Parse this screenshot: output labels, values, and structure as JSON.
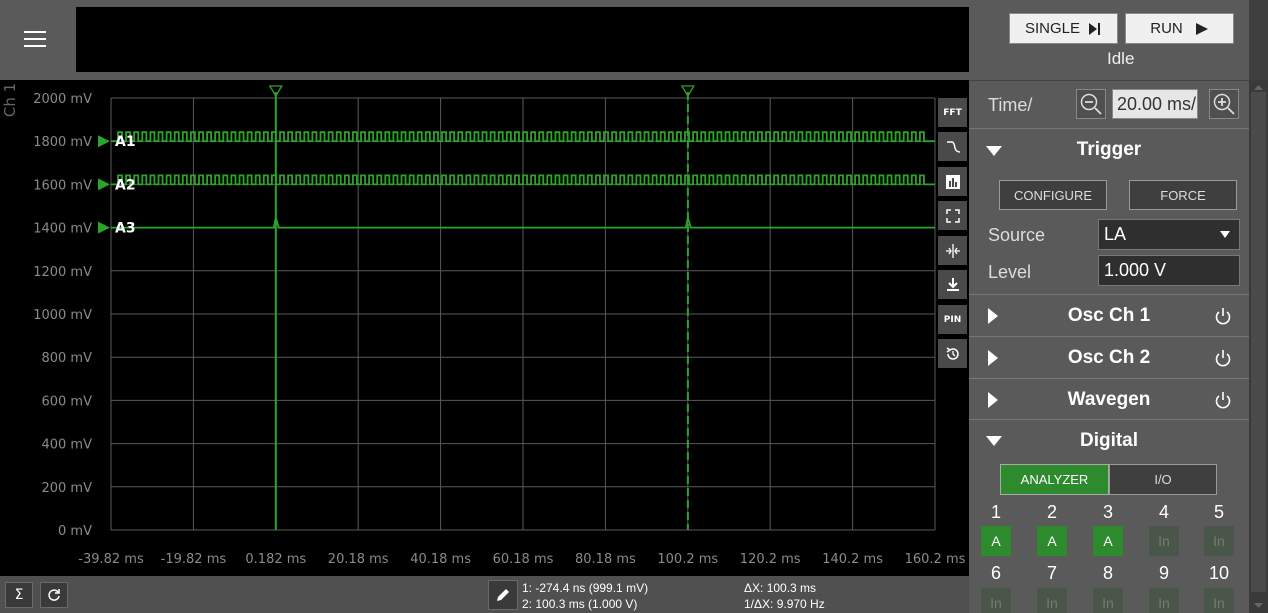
{
  "header": {
    "menu_icon": "hamburger-icon"
  },
  "plot": {
    "channel_label": "Ch 1",
    "y_ticks": [
      "2000 mV",
      "1800 mV",
      "1600 mV",
      "1400 mV",
      "1200 mV",
      "1000 mV",
      "800 mV",
      "600 mV",
      "400 mV",
      "200 mV",
      "0 mV"
    ],
    "x_ticks": [
      "-39.82 ms",
      "-19.82 ms",
      "0.182 ms",
      "20.18 ms",
      "40.18 ms",
      "60.18 ms",
      "80.18 ms",
      "100.2 ms",
      "120.2 ms",
      "140.2 ms",
      "160.2 ms"
    ],
    "channels": [
      {
        "label": "A1",
        "level_mv": 1800,
        "pattern": "square"
      },
      {
        "label": "A2",
        "level_mv": 1600,
        "pattern": "square"
      },
      {
        "label": "A3",
        "level_mv": 1400,
        "pattern": "flat"
      }
    ],
    "trace_color": "#2aa52a",
    "cursors_ms": [
      0.182,
      100.2
    ]
  },
  "tools": [
    "FFT",
    "~",
    "bar-chart-icon",
    "fullscreen-icon",
    "fit-icon",
    "download-icon",
    "PIN",
    "reset-icon"
  ],
  "tool_labels": {
    "fft": "FFT",
    "pin": "PIN"
  },
  "bottom": {
    "cursor1": "1: -274.4 ns (999.1 mV)",
    "cursor2": "2: 100.3 ms (1.000 V)",
    "delta_x": "ΔX: 100.3 ms",
    "inv_delta_x": "1/ΔX: 9.970 Hz"
  },
  "panel": {
    "single_label": "SINGLE",
    "run_label": "RUN",
    "status": "Idle",
    "time_label": "Time/",
    "time_value": "20.00 ms/",
    "trigger": {
      "title": "Trigger",
      "configure": "CONFIGURE",
      "force": "FORCE",
      "source_label": "Source",
      "source_value": "LA",
      "level_label": "Level",
      "level_value": "1.000 V"
    },
    "sections": [
      "Osc Ch 1",
      "Osc Ch 2",
      "Wavegen"
    ],
    "digital": {
      "title": "Digital",
      "analyzer": "ANALYZER",
      "io": "I/O",
      "pins_row1": [
        {
          "num": "1",
          "state": "A",
          "on": true
        },
        {
          "num": "2",
          "state": "A",
          "on": true
        },
        {
          "num": "3",
          "state": "A",
          "on": true
        },
        {
          "num": "4",
          "state": "In",
          "on": false
        },
        {
          "num": "5",
          "state": "In",
          "on": false
        }
      ],
      "pins_row2": [
        {
          "num": "6",
          "state": "In",
          "on": false
        },
        {
          "num": "7",
          "state": "In",
          "on": false
        },
        {
          "num": "8",
          "state": "In",
          "on": false
        },
        {
          "num": "9",
          "state": "In",
          "on": false
        },
        {
          "num": "10",
          "state": "In",
          "on": false
        }
      ]
    }
  }
}
